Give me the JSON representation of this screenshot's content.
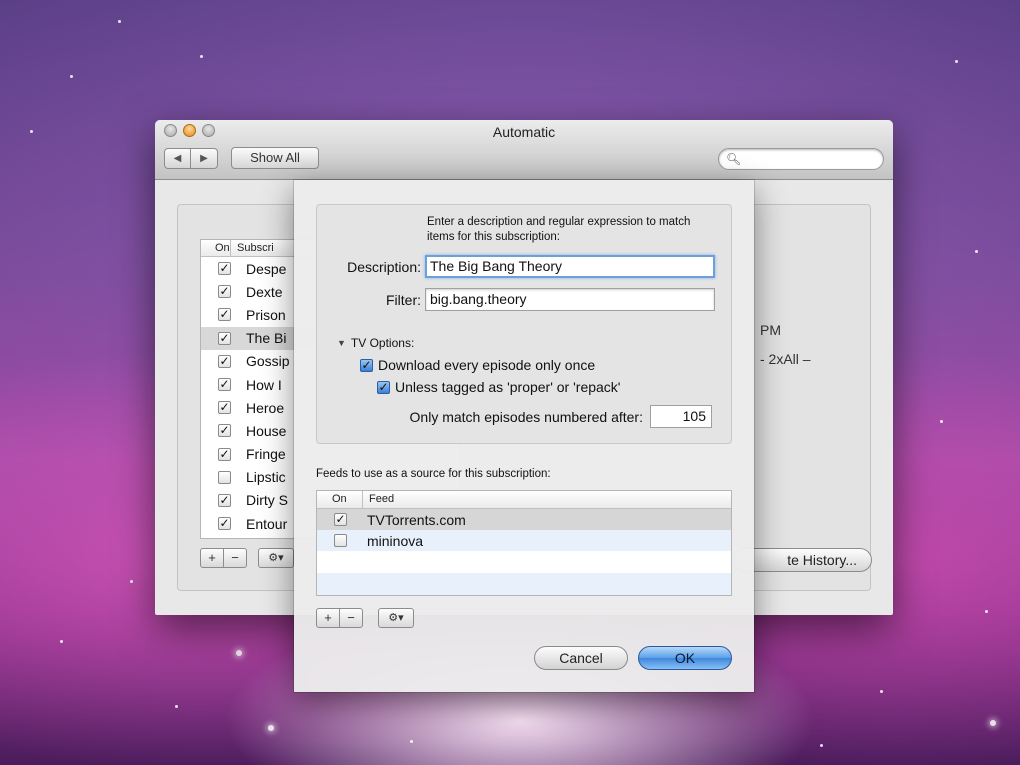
{
  "window": {
    "title": "Automatic",
    "nav_back": "◀",
    "nav_forward": "▶",
    "show_all": "Show All",
    "search_placeholder": ""
  },
  "subscriptions": {
    "header_on": "On",
    "header_subscription": "Subscri",
    "rows": [
      {
        "name": "Despe",
        "checked": true
      },
      {
        "name": "Dexte",
        "checked": true
      },
      {
        "name": "Prison",
        "checked": true
      },
      {
        "name": "The Bi",
        "checked": true,
        "selected": true
      },
      {
        "name": "Gossip",
        "checked": true
      },
      {
        "name": "How I",
        "checked": true
      },
      {
        "name": "Heroe",
        "checked": true
      },
      {
        "name": "House",
        "checked": true
      },
      {
        "name": "Fringe",
        "checked": true
      },
      {
        "name": "Lipstic",
        "checked": false
      },
      {
        "name": "Dirty S",
        "checked": true
      },
      {
        "name": "Entour",
        "checked": true
      }
    ],
    "add_label": "+",
    "remove_label": "−",
    "gear_label": "⚙▾"
  },
  "background_detail": {
    "time_suffix": "PM",
    "episode_suffix": "- 2xAll –",
    "history_button": "te History..."
  },
  "sheet": {
    "intro_text": "Enter a description and  regular expression to match items for this subscription:",
    "description_label": "Description:",
    "description_value": "The Big Bang Theory",
    "filter_label": "Filter:",
    "filter_value": "big.bang.theory",
    "tv_options_label": "TV Options:",
    "download_once_label": "Download every episode only once",
    "download_once_checked": true,
    "unless_tagged_label": "Unless tagged as 'proper' or 'repack'",
    "unless_tagged_checked": true,
    "match_after_label": "Only match episodes numbered after:",
    "match_after_value": "105",
    "feeds_label": "Feeds to use as a source for this subscription:",
    "feed_header_on": "On",
    "feed_header_feed": "Feed",
    "feeds": [
      {
        "name": "TVTorrents.com",
        "checked": true
      },
      {
        "name": "mininova",
        "checked": false
      }
    ],
    "add_label": "+",
    "remove_label": "−",
    "gear_label": "⚙▾",
    "cancel_label": "Cancel",
    "ok_label": "OK"
  },
  "colors": {
    "accent": "#3f86dc",
    "focus_ring": "#6e9fd9"
  }
}
